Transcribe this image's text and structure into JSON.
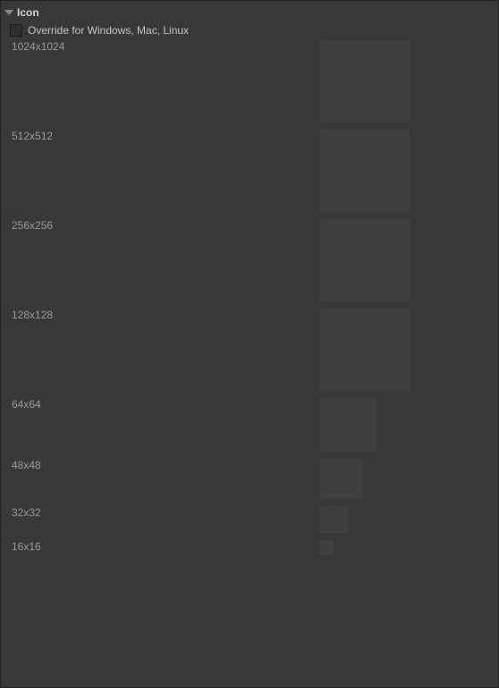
{
  "section": {
    "title": "Icon"
  },
  "override": {
    "label": "Override for Windows, Mac, Linux",
    "checked": false
  },
  "sizes": [
    {
      "label": "1024x1024",
      "preview_w": 100,
      "preview_h": 92
    },
    {
      "label": "512x512",
      "preview_w": 100,
      "preview_h": 92
    },
    {
      "label": "256x256",
      "preview_w": 100,
      "preview_h": 92
    },
    {
      "label": "128x128",
      "preview_w": 100,
      "preview_h": 92
    },
    {
      "label": "64x64",
      "preview_w": 64,
      "preview_h": 60
    },
    {
      "label": "48x48",
      "preview_w": 48,
      "preview_h": 45
    },
    {
      "label": "32x32",
      "preview_w": 32,
      "preview_h": 30
    },
    {
      "label": "16x16",
      "preview_w": 16,
      "preview_h": 16
    }
  ]
}
